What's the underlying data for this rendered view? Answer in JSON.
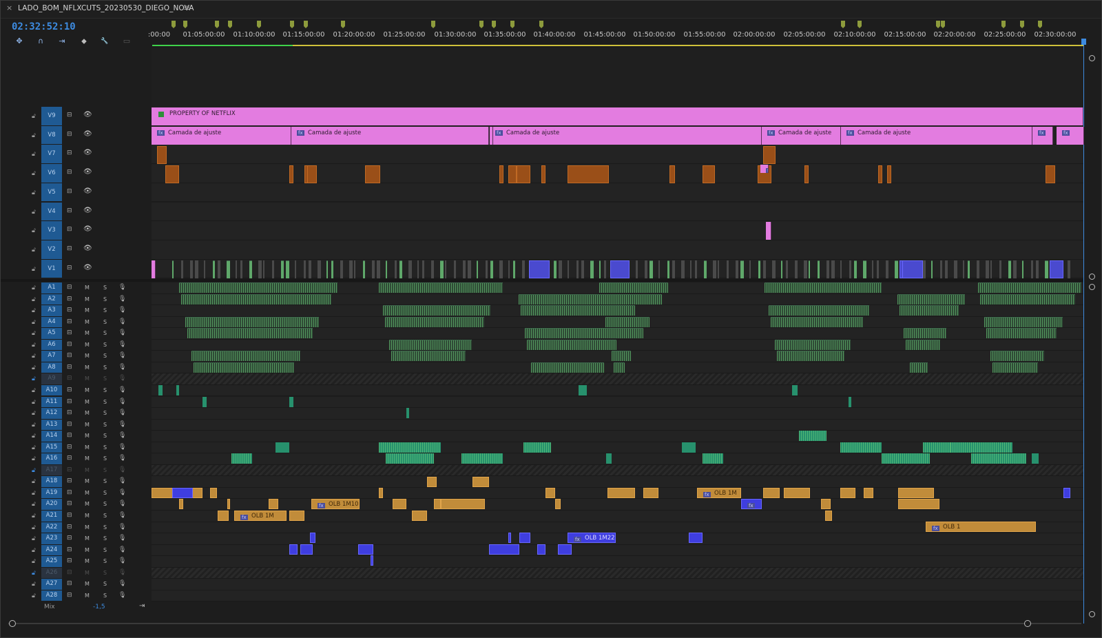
{
  "panel": {
    "close_glyph": "×",
    "sequence_name": "LADO_BOM_NFLXCUTS_20230530_DIEGO_NOVA",
    "menu_glyph": "≡",
    "timecode": "02:32:52:10"
  },
  "toolbar": {
    "tools": [
      "snap-icon",
      "magnet-icon",
      "linked-selection-icon",
      "add-marker-icon",
      "wrench-icon",
      "captions-icon"
    ],
    "glyphs": [
      "✥",
      "∩",
      "⇥",
      "⬥",
      "🔧",
      "▭"
    ]
  },
  "ruler": {
    "ticks": [
      ":00:00",
      "01:05:00:00",
      "01:10:00:00",
      "01:15:00:00",
      "01:20:00:00",
      "01:25:00:00",
      "01:30:00:00",
      "01:35:00:00",
      "01:40:00:00",
      "01:45:00:00",
      "01:50:00:00",
      "01:55:00:00",
      "02:00:00:00",
      "02:05:00:00",
      "02:10:00:00",
      "02:15:00:00",
      "02:20:00:00",
      "02:25:00:00",
      "02:30:00:00"
    ]
  },
  "video_tracks": [
    {
      "name": "V9"
    },
    {
      "name": "V8"
    },
    {
      "name": "V7"
    },
    {
      "name": "V6"
    },
    {
      "name": "V5"
    },
    {
      "name": "V4"
    },
    {
      "name": "V3"
    },
    {
      "name": "V2"
    },
    {
      "name": "V1"
    }
  ],
  "audio_tracks": [
    {
      "name": "A1",
      "enabled": true
    },
    {
      "name": "A2",
      "enabled": true
    },
    {
      "name": "A3",
      "enabled": true
    },
    {
      "name": "A4",
      "enabled": true
    },
    {
      "name": "A5",
      "enabled": true
    },
    {
      "name": "A6",
      "enabled": true
    },
    {
      "name": "A7",
      "enabled": true
    },
    {
      "name": "A8",
      "enabled": true
    },
    {
      "name": "A9",
      "enabled": false
    },
    {
      "name": "A10",
      "enabled": true
    },
    {
      "name": "A11",
      "enabled": true
    },
    {
      "name": "A12",
      "enabled": true
    },
    {
      "name": "A13",
      "enabled": true
    },
    {
      "name": "A14",
      "enabled": true
    },
    {
      "name": "A15",
      "enabled": true
    },
    {
      "name": "A16",
      "enabled": true
    },
    {
      "name": "A17",
      "enabled": false
    },
    {
      "name": "A18",
      "enabled": true
    },
    {
      "name": "A19",
      "enabled": true
    },
    {
      "name": "A20",
      "enabled": true
    },
    {
      "name": "A21",
      "enabled": true
    },
    {
      "name": "A22",
      "enabled": true
    },
    {
      "name": "A23",
      "enabled": true
    },
    {
      "name": "A24",
      "enabled": true
    },
    {
      "name": "A25",
      "enabled": true
    },
    {
      "name": "A26",
      "enabled": false
    },
    {
      "name": "A27",
      "enabled": true
    },
    {
      "name": "A28",
      "enabled": true
    }
  ],
  "track_controls": {
    "mute": "M",
    "solo": "S",
    "mix_label": "Mix",
    "mix_value": "-1,5"
  },
  "clips": {
    "v9_title": "PROPERTY OF NETFLIX",
    "adjustment_label": "Camada de ajuste",
    "fx_badge": "fx",
    "olb_1m10": "OLB 1M10",
    "olb_1m": "OLB 1M",
    "olb_1m_b": "OLB 1M",
    "olb_1m22": "OLB 1M22",
    "olb_1": "OLB 1"
  },
  "colors": {
    "timecode": "#3d8be0",
    "track_target": "#1f5a93",
    "adjustment_clip": "#e37ce0",
    "video_clip": "#9a4f18",
    "music_clip": "#c18c3a",
    "blue_clip": "#3f3ee0",
    "audio_wave": "#6fd27b",
    "marker": "#8d9b3c"
  }
}
